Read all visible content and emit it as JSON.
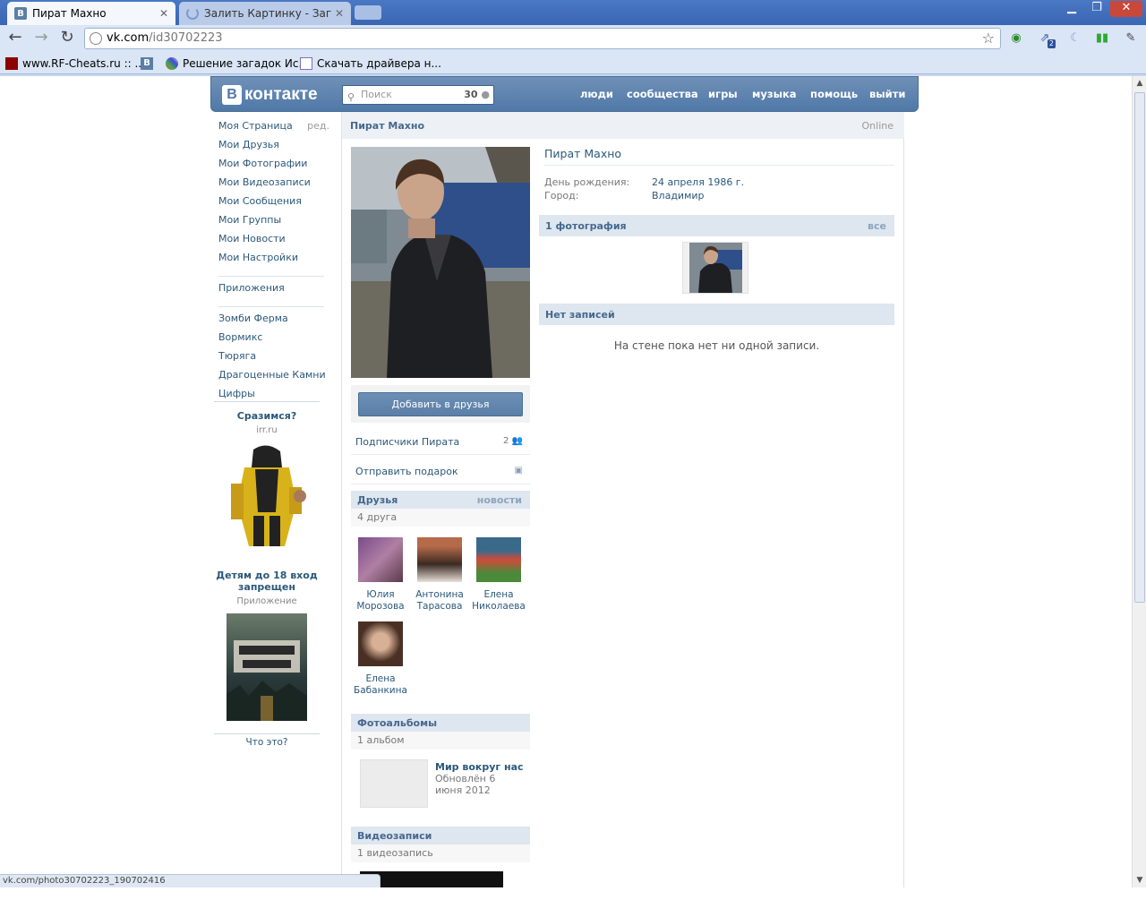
{
  "browser": {
    "tabs": [
      {
        "title": "Пират Махно",
        "active": true
      },
      {
        "title": "Залить Картинку - Загрузить",
        "active": false
      }
    ],
    "url_host": "vk.com",
    "url_path": "/id30702223",
    "extension_badge": "2",
    "bookmarks": [
      {
        "label": "www.RF-Cheats.ru :: ..."
      },
      {
        "label": ""
      },
      {
        "label": "Решение загадок Ис..."
      },
      {
        "label": "Скачать драйвера н..."
      }
    ],
    "status_text": "vk.com/photo30702223_190702416"
  },
  "vk": {
    "logo_text": "контакте",
    "logo_letter": "В",
    "search_placeholder": "Поиск",
    "search_count": "30",
    "nav": [
      "люди",
      "сообщества",
      "игры",
      "музыка",
      "помощь",
      "выйти"
    ]
  },
  "left_menu": {
    "items": [
      "Моя Страница",
      "Мои Друзья",
      "Мои Фотографии",
      "Мои Видеозаписи",
      "Мои Сообщения",
      "Мои Группы",
      "Мои Новости",
      "Мои Настройки"
    ],
    "edit_label": "ред.",
    "apps_label": "Приложения",
    "apps": [
      "Зомби Ферма",
      "Вормикс",
      "Тюряга",
      "Драгоценные Камни",
      "Цифры"
    ],
    "ad1": {
      "title": "Сразимся?",
      "sub": "irr.ru"
    },
    "ad2": {
      "title": "Детям до 18 вход запрещен",
      "sub": "Приложение"
    },
    "ad_what": "Что это?"
  },
  "profile": {
    "header_name": "Пират Махно",
    "online": "Online",
    "name": "Пират Махно",
    "birthday_label": "День рождения:",
    "birthday": "24 апреля 1986 г.",
    "city_label": "Город:",
    "city": "Владимир",
    "add_friend": "Добавить в друзья",
    "followers_label": "Подписчики Пирата",
    "followers_count": "2",
    "gift_label": "Отправить подарок",
    "photos_title": "1 фотография",
    "photos_all": "все",
    "wall_title": "Нет записей",
    "wall_empty": "На стене пока нет ни одной записи."
  },
  "friends": {
    "title": "Друзья",
    "news": "новости",
    "count": "4 друга",
    "list": [
      {
        "first": "Юлия",
        "last": "Морозова"
      },
      {
        "first": "Антонина",
        "last": "Тарасова"
      },
      {
        "first": "Елена",
        "last": "Николаева"
      },
      {
        "first": "Елена",
        "last": "Бабанкина"
      }
    ]
  },
  "albums": {
    "title": "Фотоальбомы",
    "count": "1 альбом",
    "name": "Мир вокруг нас",
    "updated": "Обновлён 6 июня 2012"
  },
  "videos": {
    "title": "Видеозаписи",
    "count": "1 видеозапись"
  },
  "colors": {
    "vk_blue": "#5079a8",
    "link": "#2b587a",
    "block_header": "#dee6ef"
  }
}
